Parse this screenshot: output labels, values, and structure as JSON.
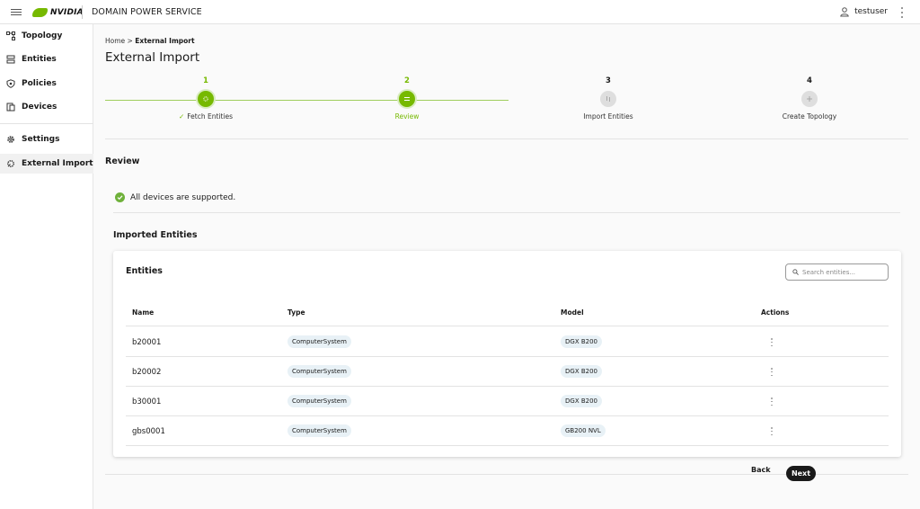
{
  "header": {
    "brand": "NVIDIA",
    "app_title": "DOMAIN POWER SERVICE",
    "username": "testuser"
  },
  "sidebar": {
    "items": [
      {
        "label": "Topology",
        "icon": "topology-icon"
      },
      {
        "label": "Entities",
        "icon": "entities-icon"
      },
      {
        "label": "Policies",
        "icon": "policies-icon"
      },
      {
        "label": "Devices",
        "icon": "devices-icon"
      },
      {
        "label": "Settings",
        "icon": "gear-icon"
      },
      {
        "label": "External Import",
        "icon": "import-icon",
        "active": true
      }
    ]
  },
  "breadcrumb": {
    "home": "Home",
    "separator": ">",
    "current": "External Import"
  },
  "page": {
    "title": "External Import"
  },
  "stepper": {
    "steps": [
      {
        "number": "1",
        "label": "Fetch Entities",
        "state": "done",
        "check": "✓"
      },
      {
        "number": "2",
        "label": "Review",
        "state": "current"
      },
      {
        "number": "3",
        "label": "Import Entities",
        "state": "pending"
      },
      {
        "number": "4",
        "label": "Create Topology",
        "state": "pending"
      }
    ]
  },
  "review": {
    "title": "Review",
    "support_message": "All devices are supported."
  },
  "imported": {
    "title": "Imported Entities",
    "card_title": "Entities",
    "search_placeholder": "Search entities...",
    "columns": [
      "Name",
      "Type",
      "Model",
      "Actions"
    ],
    "rows": [
      {
        "name": "b20001",
        "type": "ComputerSystem",
        "model": "DGX B200"
      },
      {
        "name": "b20002",
        "type": "ComputerSystem",
        "model": "DGX B200"
      },
      {
        "name": "b30001",
        "type": "ComputerSystem",
        "model": "DGX B200"
      },
      {
        "name": "gbs0001",
        "type": "ComputerSystem",
        "model": "GB200 NVL"
      }
    ]
  },
  "footer": {
    "back_label": "Back",
    "next_label": "Next"
  },
  "colors": {
    "accent_green": "#76b900",
    "pill_background": "#e8f1f6",
    "primary_button": "#1a1a1a"
  }
}
